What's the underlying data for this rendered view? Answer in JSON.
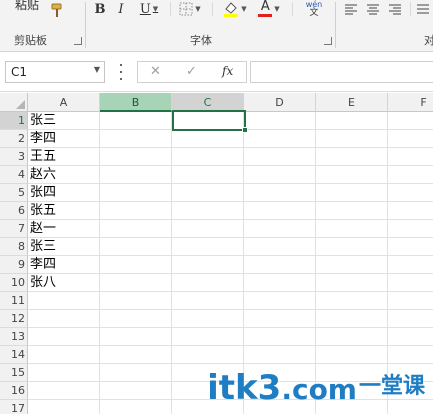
{
  "ribbon": {
    "paste_label": "粘贴",
    "clipboard_label": "剪贴板",
    "font_group_label": "字体",
    "alignment_group_label": "对",
    "bold": "B",
    "italic": "I",
    "underline": "U",
    "font_color_glyph": "A",
    "phonetic_glyph": "wén",
    "phonetic_sub": "文",
    "highlight_color": "#ffff00",
    "font_color": "#e02020"
  },
  "formula_bar": {
    "name_box": "C1",
    "cancel_glyph": "✕",
    "enter_glyph": "✓",
    "fx_glyph": "fx",
    "formula": ""
  },
  "grid": {
    "columns": [
      "A",
      "B",
      "C",
      "D",
      "E",
      "F"
    ],
    "rows": [
      "1",
      "2",
      "3",
      "4",
      "5",
      "6",
      "7",
      "8",
      "9",
      "10",
      "11",
      "12",
      "13",
      "14",
      "15",
      "16",
      "17"
    ],
    "cells_a": [
      "张三",
      "李四",
      "王五",
      "赵六",
      "张四",
      "张五",
      "赵一",
      "张三",
      "李四",
      "张八"
    ],
    "selected_column": "B",
    "active_cell": "C1",
    "accent": "#217346"
  },
  "watermark": {
    "text": "itk3",
    "suffix": ".com",
    "cn": "一堂课"
  }
}
